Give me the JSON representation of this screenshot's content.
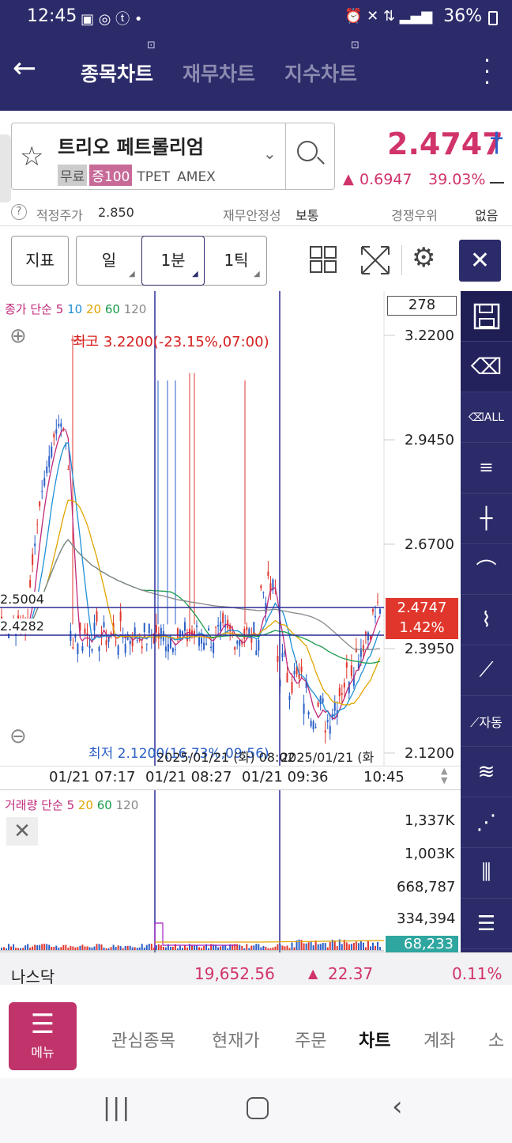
{
  "status": {
    "time": "12:45",
    "battery": "36%"
  },
  "appbar": {
    "tabs": [
      "종목차트",
      "재무차트",
      "지수차트"
    ]
  },
  "stock": {
    "name": "트리오 페트롤리엄",
    "tags": [
      "무료",
      "증100",
      "TPET",
      "AMEX"
    ],
    "price": "2.4747",
    "change": "0.6947",
    "change_pct": "39.03%"
  },
  "info": {
    "fair_label": "적정주가",
    "fair_value": "2.850",
    "fin_label": "재무안정성",
    "fin_value": "보통",
    "comp_label": "경쟁우위",
    "comp_value": "없음"
  },
  "toolbar": {
    "indicator": "지표",
    "day": "일",
    "min": "1분",
    "tick": "1틱"
  },
  "chart": {
    "count": "278",
    "legend_prefix": "종가 단순",
    "ma": [
      "5",
      "10",
      "20",
      "60",
      "120"
    ],
    "high_label": "최고 3.2200(-23.15%,07:00)",
    "low_label": "최저 2.1200(16.73%,09:56)",
    "y_labels": [
      "3.2200",
      "2.9450",
      "2.6700",
      "2.3950",
      "2.1200"
    ],
    "cur_price": "2.4747",
    "cur_pct": "1.42%",
    "left_label_1": "2.5004",
    "left_label_2": "2.4282",
    "x_labels": [
      "01/21 07:17",
      "01/21 08:27",
      "01/21 09:36",
      "10:45"
    ],
    "overlay_date_1": "2025/01/21 (화) 08:02",
    "overlay_date_2": "2025/01/21 (화"
  },
  "volume": {
    "legend_prefix": "거래량 단순",
    "ma": [
      "5",
      "20",
      "60",
      "120"
    ],
    "y_labels": [
      "1,337K",
      "1,003K",
      "668,787",
      "334,394"
    ],
    "current": "68,233"
  },
  "index": {
    "name": "나스닥",
    "value": "19,652.56",
    "change": "22.37",
    "pct": "0.11%"
  },
  "nav": {
    "menu": "메뉴",
    "items": [
      "관심종목",
      "현재가",
      "주문",
      "차트",
      "계좌",
      "소"
    ]
  },
  "colors": {
    "primary": "#2c2b6a",
    "up": "#d1336b",
    "down": "#2a5fc7"
  }
}
